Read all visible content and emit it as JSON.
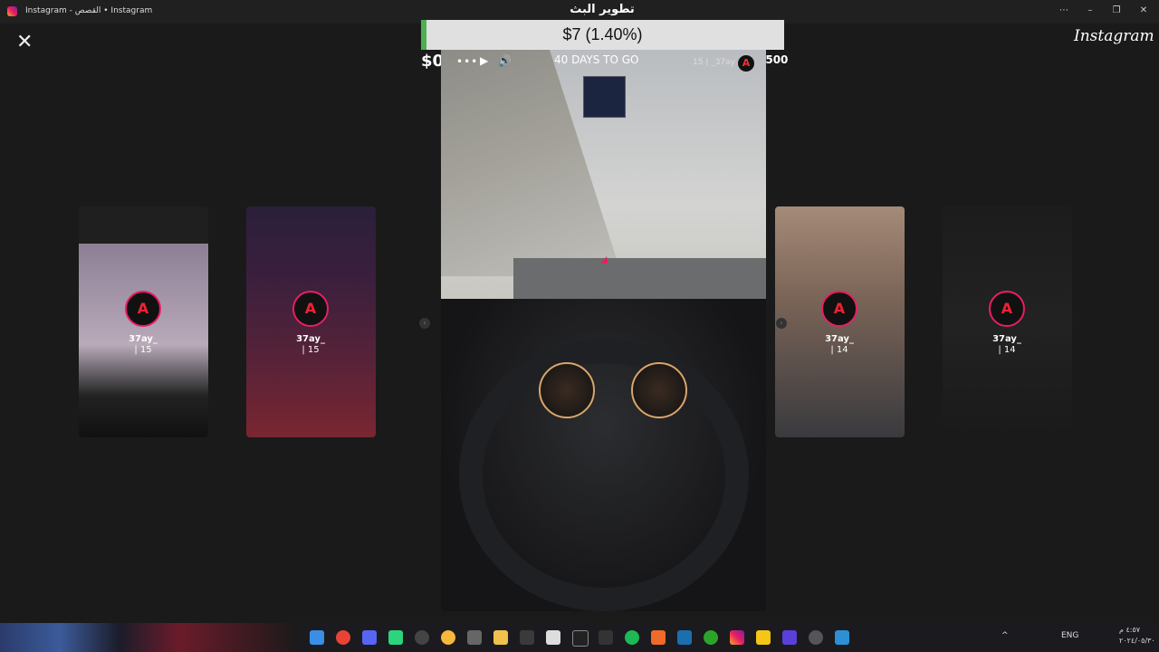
{
  "window": {
    "title": "Instagram - القصص • Instagram",
    "minimize": "–",
    "restore": "❐",
    "close": "✕",
    "more": "⋯"
  },
  "overlay": {
    "close_label": "✕",
    "brand": "Instagram",
    "arabic_title": "تطوير البث",
    "funding_text": "$7 (1.40%)",
    "funding_fraction": 0.014,
    "amount_left": "$0",
    "amount_right": "$500"
  },
  "story": {
    "dots": "•••",
    "play": "▶",
    "volume": "🔊",
    "countdown": "40 DAYS TO GO",
    "user_time": "15 | _37ay",
    "avatar_letter": "A"
  },
  "cards": [
    {
      "name": "37ay_",
      "time": "| 15",
      "letter": "A"
    },
    {
      "name": "37ay_",
      "time": "| 15",
      "letter": "A"
    },
    {
      "name": "37ay_",
      "time": "| 14",
      "letter": "A"
    },
    {
      "name": "37ay_",
      "time": "| 14",
      "letter": "A"
    }
  ],
  "nav": {
    "prev": "‹",
    "next": "›"
  },
  "tray": {
    "lang": "ENG",
    "time": "٤:٥٧ م",
    "date": "٢٠٢٤/٠٥/٣٠"
  },
  "colors": {
    "funding_green": "#4caf50",
    "ring": "#e91e63"
  }
}
